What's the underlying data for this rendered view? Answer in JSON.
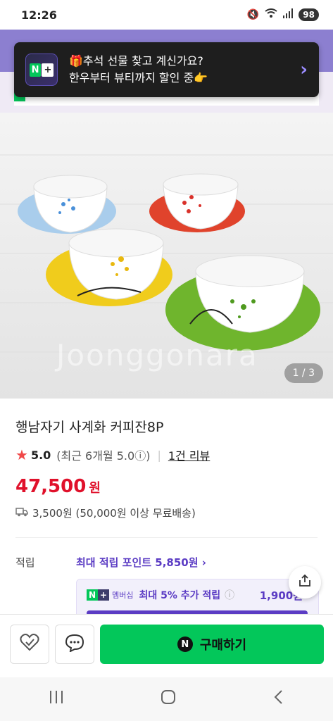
{
  "status_bar": {
    "time": "12:26",
    "battery": "98",
    "icons": [
      "mute-icon",
      "wifi-icon",
      "signal-icon"
    ]
  },
  "promo": {
    "line1": "🎁추석 선물 찾고 계신가요?",
    "line2": "한우부터 뷰티까지 할인 중👉",
    "logo_n": "N",
    "logo_plus": "+"
  },
  "gallery": {
    "counter": "1 / 3",
    "watermark": "Joonggonara"
  },
  "product": {
    "title": "행남자기 사계화 커피잔8P",
    "rating": "5.0",
    "rating_note": "(최근 6개월 5.0ⓘ)",
    "review_link": "1건 리뷰",
    "price": "47,500",
    "price_unit": "원",
    "shipping": "3,500원 (50,000원 이상 무료배송)"
  },
  "points": {
    "label": "적립",
    "max_text": "최대 적립 포인트 5,850원 ›",
    "member_tag": "멤버십",
    "member_text": "최대 5% 추가 적립",
    "member_amount": "1,900원"
  },
  "actions": {
    "buy_label": "구매하기",
    "buy_logo": "N"
  },
  "colors": {
    "accent_green": "#03c75a",
    "price_red": "#e0112b",
    "point_purple": "#5b3cc4"
  }
}
